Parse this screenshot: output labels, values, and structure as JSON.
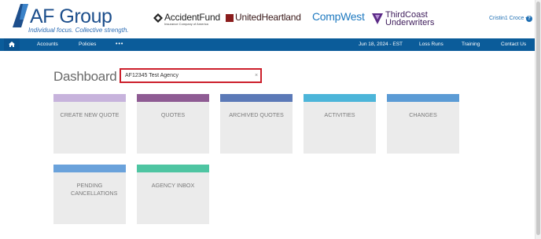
{
  "header": {
    "logo_name": "AF Group",
    "logo_tagline": "Individual focus. Collective strength.",
    "brands": {
      "accident_fund": {
        "name": "AccidentFund",
        "sub": "Insurance Company of America"
      },
      "united_heartland": {
        "name": "UnitedHeartland"
      },
      "compwest": {
        "name": "CompWest"
      },
      "third_coast": {
        "name_line1": "ThirdCoast",
        "name_line2": "Underwriters"
      }
    },
    "user_name": "Cristin1 Croce",
    "user_caret": "▾",
    "help_icon": "?"
  },
  "navbar": {
    "accounts": "Accounts",
    "policies": "Policies",
    "more": "•••",
    "date": "Jun 18, 2024 - EST",
    "loss_runs": "Loss Runs",
    "training": "Training",
    "contact_us": "Contact Us"
  },
  "main": {
    "title": "Dashboard",
    "agency_select": {
      "value": "AF12345 Test Agency",
      "clear": "×"
    },
    "tiles": [
      {
        "label": "CREATE NEW QUOTE",
        "color": "#c7b3dc"
      },
      {
        "label": "QUOTES",
        "color": "#8e5b93"
      },
      {
        "label": "ARCHIVED QUOTES",
        "color": "#5b79b7"
      },
      {
        "label": "ACTIVITIES",
        "color": "#4cb5d9"
      },
      {
        "label": "CHANGES",
        "color": "#5b9bd5"
      },
      {
        "label": "PENDING CANCELLATIONS",
        "color": "#6aa2db"
      },
      {
        "label": "AGENCY INBOX",
        "color": "#4ec5a2"
      }
    ]
  },
  "colors": {
    "navbar": "#0b5c9a",
    "brand_blue": "#1d4f8c",
    "select_border": "#cc1f2b"
  }
}
